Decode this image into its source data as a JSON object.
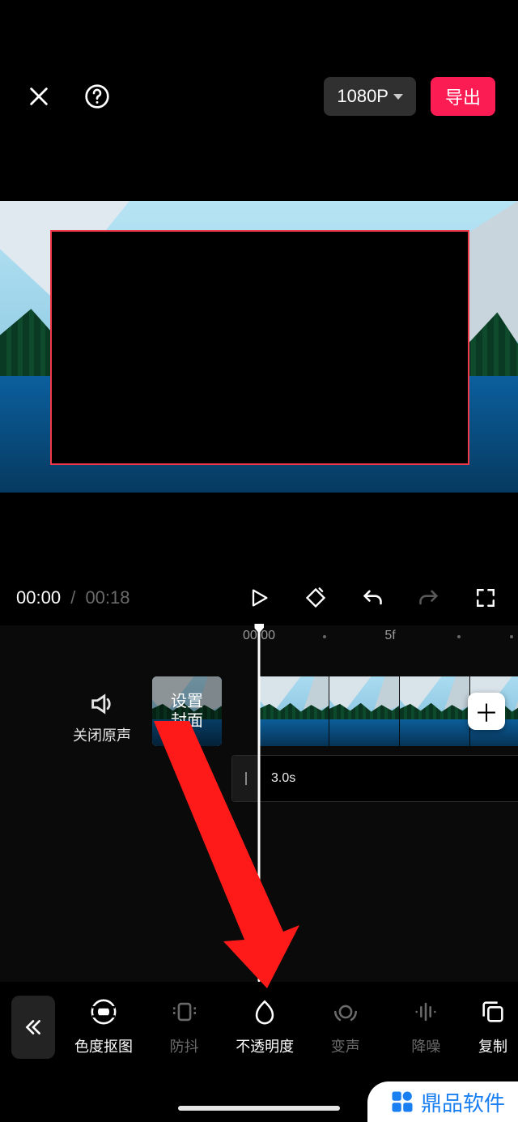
{
  "header": {
    "resolution_label": "1080P",
    "export_label": "导出"
  },
  "transport": {
    "current_time": "00:00",
    "separator": "/",
    "duration": "00:18"
  },
  "timeline": {
    "ruler": {
      "t1": "00:00",
      "t2": "5f"
    },
    "mute_label": "关闭原声",
    "cover_label": "设置\n封面",
    "pip_duration": "3.0s"
  },
  "toolbar": {
    "items": [
      {
        "label": "色度抠图",
        "state": "active"
      },
      {
        "label": "防抖",
        "state": "dim"
      },
      {
        "label": "不透明度",
        "state": "active"
      },
      {
        "label": "变声",
        "state": "dim"
      },
      {
        "label": "降噪",
        "state": "dim"
      },
      {
        "label": "复制",
        "state": "active"
      }
    ]
  },
  "watermark": {
    "text": "鼎品软件"
  }
}
